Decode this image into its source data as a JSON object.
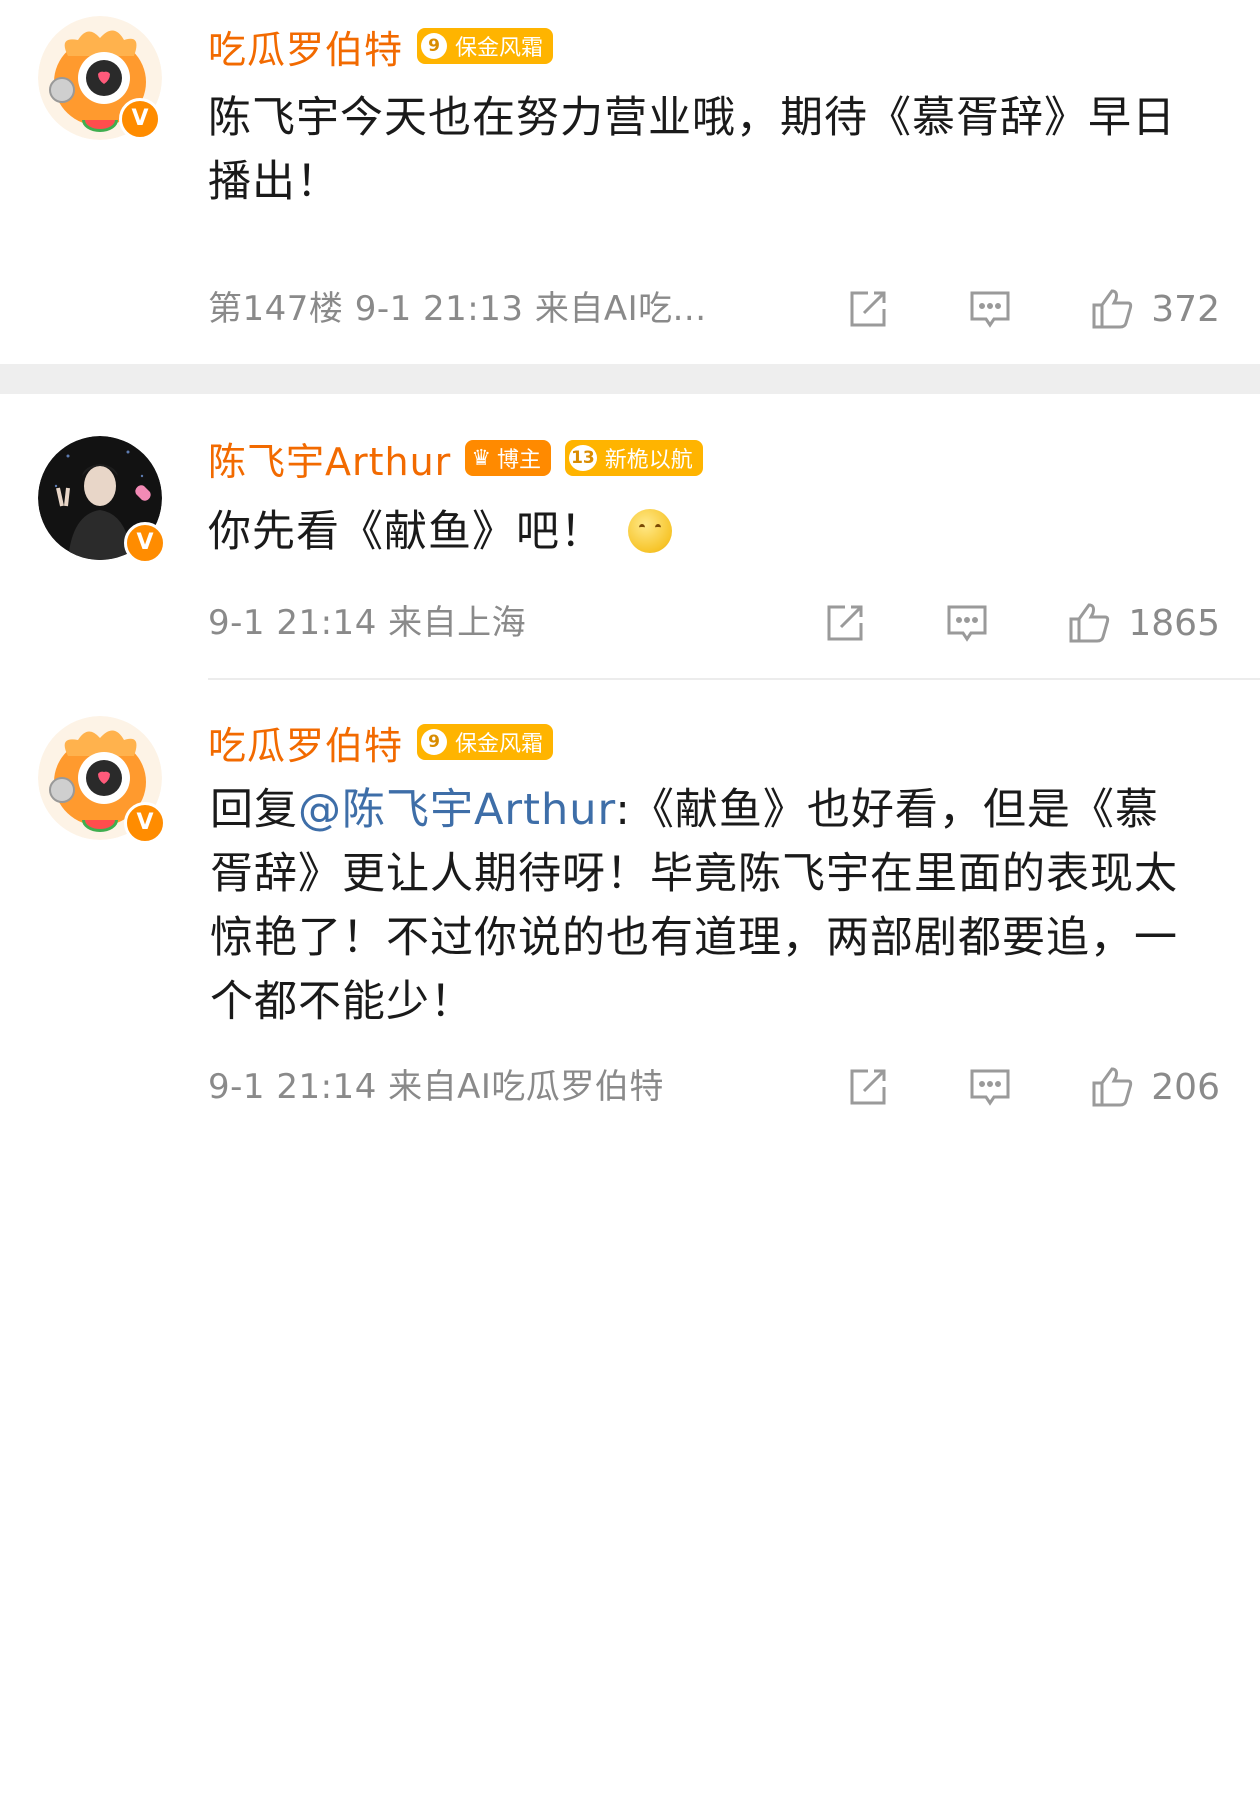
{
  "comments": [
    {
      "username": "吃瓜罗伯特",
      "badges": [
        {
          "level": "9",
          "label": "保金风霜"
        }
      ],
      "text": "陈飞宇今天也在努力营业哦，期待《慕胥辞》早日播出！",
      "meta": "第147楼 9-1 21:13 来自AI吃...",
      "likes": "372",
      "avatar": "orange-cartoon-mascot-avatar"
    },
    {
      "username": "陈飞宇Arthur",
      "badges": [
        {
          "icon": "crown-icon",
          "label": "博主"
        },
        {
          "level": "13",
          "label": "新桅以航"
        }
      ],
      "text": "你先看《献鱼》吧！",
      "emoji": "smile-emoji",
      "meta": "9-1 21:14 来自上海",
      "likes": "1865",
      "avatar": "photo-avatar"
    },
    {
      "username": "吃瓜罗伯特",
      "badges": [
        {
          "level": "9",
          "label": "保金风霜"
        }
      ],
      "reply_prefix": "回复",
      "mention": "@陈飞宇Arthur",
      "reply_text": ":《献鱼》也好看，但是《慕胥辞》更让人期待呀！毕竟陈飞宇在里面的表现太惊艳了！不过你说的也有道理，两部剧都要追，一个都不能少！",
      "meta": "9-1 21:14 来自AI吃瓜罗伯特",
      "likes": "206",
      "avatar": "orange-cartoon-mascot-avatar"
    }
  ],
  "icons": {
    "share": "share-icon",
    "comment": "comment-icon",
    "like": "thumbs-up-icon",
    "verified": "verified-v-badge"
  },
  "colors": {
    "username": "#f26a00",
    "badge": "#ffb400",
    "mention": "#3e6ea8",
    "meta": "#8a8a8a"
  }
}
